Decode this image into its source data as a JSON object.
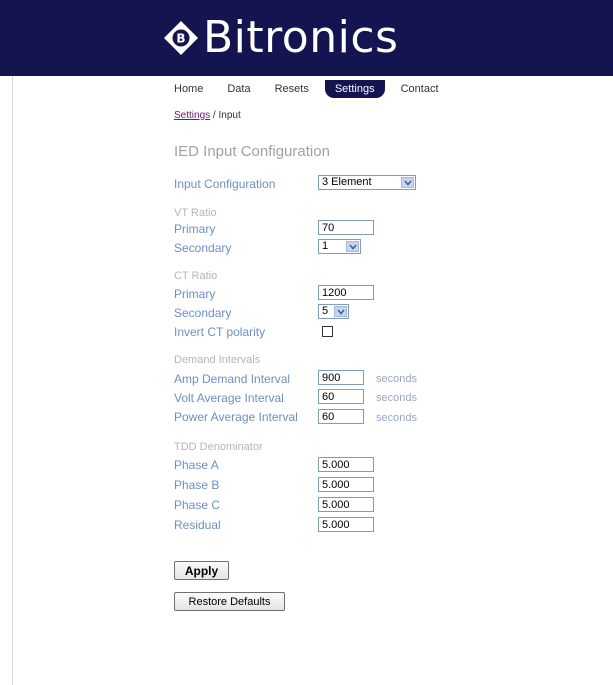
{
  "brand": {
    "name": "Bitronics"
  },
  "nav": {
    "home": "Home",
    "data": "Data",
    "resets": "Resets",
    "settings": "Settings",
    "contact": "Contact"
  },
  "breadcrumb": {
    "parent": "Settings",
    "current": "Input"
  },
  "page_title": "IED Input Configuration",
  "input_config": {
    "label": "Input Configuration",
    "value": "3 Element"
  },
  "vt_ratio": {
    "heading": "VT Ratio",
    "primary_label": "Primary",
    "primary_value": "70",
    "secondary_label": "Secondary",
    "secondary_value": "1"
  },
  "ct_ratio": {
    "heading": "CT Ratio",
    "primary_label": "Primary",
    "primary_value": "1200",
    "secondary_label": "Secondary",
    "secondary_value": "5",
    "invert_label": "Invert CT polarity",
    "invert_checked": false
  },
  "demand": {
    "heading": "Demand Intervals",
    "amp_label": "Amp Demand Interval",
    "amp_value": "900",
    "volt_label": "Volt Average Interval",
    "volt_value": "60",
    "power_label": "Power Average Interval",
    "power_value": "60",
    "unit": "seconds"
  },
  "tdd": {
    "heading": "TDD Denominator",
    "phase_a_label": "Phase A",
    "phase_a_value": "5.000",
    "phase_b_label": "Phase B",
    "phase_b_value": "5.000",
    "phase_c_label": "Phase C",
    "phase_c_value": "5.000",
    "residual_label": "Residual",
    "residual_value": "5.000"
  },
  "buttons": {
    "apply": "Apply",
    "restore": "Restore Defaults"
  },
  "colors": {
    "banner": "#141450",
    "label": "#6d8fc2",
    "section": "#b4b4bc",
    "link": "#6a1a6a"
  }
}
